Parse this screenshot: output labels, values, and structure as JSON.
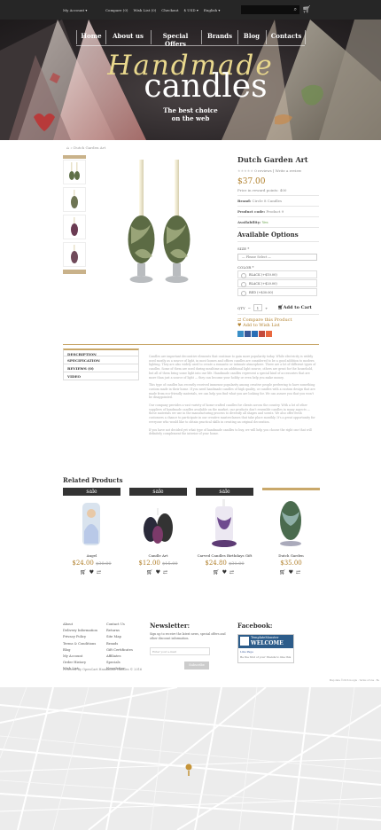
{
  "topbar": {
    "account": "My Account ▾",
    "compare": "Compare (0)",
    "wishlist": "Wish List (0)",
    "checkout": "Checkout",
    "currency": "$ USD ▾",
    "language": "English ▾"
  },
  "nav": [
    "Home",
    "About us",
    "Special Offers",
    "Brands",
    "Blog",
    "Contacts"
  ],
  "hero": {
    "title1": "Handmade",
    "title2": "candles",
    "tag1": "The best choice",
    "tag2": "on the web"
  },
  "breadcrumb": "⌂ » Dutch Garden Art",
  "product": {
    "name": "Dutch Garden Art",
    "reviews": "0 reviews",
    "write_review": "Write a review",
    "price": "$37.00",
    "ex_tax": "Price in reward points: 400",
    "brand_label": "Brand:",
    "brand": "Circle 8 Candles",
    "code_label": "Product code:",
    "code": "Product 9",
    "avail_label": "Availability:",
    "avail": "Yes",
    "options_title": "Available Options",
    "size_label": "SIZE *",
    "size_sel": "— Please Select —",
    "color_label": "COLOR *",
    "colors": [
      "BLACK (+$10.00)",
      "BLACK (+$20.00)",
      "RED (+$30.00)"
    ],
    "qty": "1",
    "add_cart": "Add to Cart",
    "compare": "Compare this Product",
    "wish": "Add to Wish List"
  },
  "tabs": [
    "DESCRIPTION",
    "SPECIFICATION",
    "REVIEWS (0)",
    "VIDEO"
  ],
  "description": [
    "Candles are important decorative elements that continue to gain more popularity today. While electricity is widely used mostly as a source of light, in most homes and offices candles are considered to be a good addition to modern lighting. They are also widely used to create a romantic or intimate atmosphere. There are a lot of different types of candles. Some of them are used during mealtime as an additional light source, others are great for the household, but all of them bring some light into our life. Handmade candles represent a special kind of accessories that are more than just a source of light — they can become your hobby or even help you make money.",
    "This type of candles has recently received immense popularity among creative people preferring to have something custom made in their home. If you need handmade candles of high quality, or candles with a custom design that are made from eco-friendly materials, we can help you find what you are looking for. We can assure you that you won't be disappointed.",
    "Our company provides a vast variety of home-crafted candles for clients across the country. With a lot of other suppliers of handmade candles available on the market, our products don't resemble candles in many aspects — these materials we use in the manufacturing process to diversify all shapes and scents. We also offer fresh customers a chance to participate in our creative masterclasses that take place monthly. It's a great opportunity for everyone who would like to obtain practical skills in creating an original decoration.",
    "If you have not decided yet what type of handmade candles to buy, we will help you choose the right one that will definitely complement the interior of your home."
  ],
  "related": {
    "title": "Related Products",
    "items": [
      {
        "badge": "sale",
        "name": "Angel",
        "price": "$24.00",
        "old": "$30.00"
      },
      {
        "badge": "sale",
        "name": "Candle Art",
        "price": "$12.00",
        "old": "$15.00"
      },
      {
        "badge": "sale",
        "name": "Carved Candles Birthdays Gift",
        "price": "$24.80",
        "old": "$31.00"
      },
      {
        "badge": "",
        "name": "Dutch Garden",
        "price": "$35.00",
        "old": ""
      }
    ]
  },
  "footer": {
    "col1": [
      "About",
      "Delivery Information",
      "Privacy Policy",
      "Terms & Conditions",
      "Blog",
      "My Account",
      "Order History",
      "Wish List"
    ],
    "col2": [
      "Contact Us",
      "Returns",
      "Site Map",
      "Brands",
      "Gift Certificates",
      "Affiliates",
      "Specials",
      "Newsletter"
    ],
    "newsletter_title": "Newsletter:",
    "newsletter_text": "Sign up to receive the latest news, special offers and other discount information.",
    "email_placeholder": "Enter your e-mail",
    "subscribe": "Subscribe",
    "facebook_title": "Facebook:",
    "fb_name": "TemplateMonster",
    "fb_welcome": "WELCOME",
    "fb_like": "Like Page",
    "fb_caption": "Be the first of your friends to like this",
    "powered": "Powered By OpenCart Handmade candles © 2016",
    "map_credit": "Map data ©2016 Google · Terms of Use · Re"
  },
  "colors": {
    "accent": "#b07f2a",
    "dark": "#262626"
  }
}
